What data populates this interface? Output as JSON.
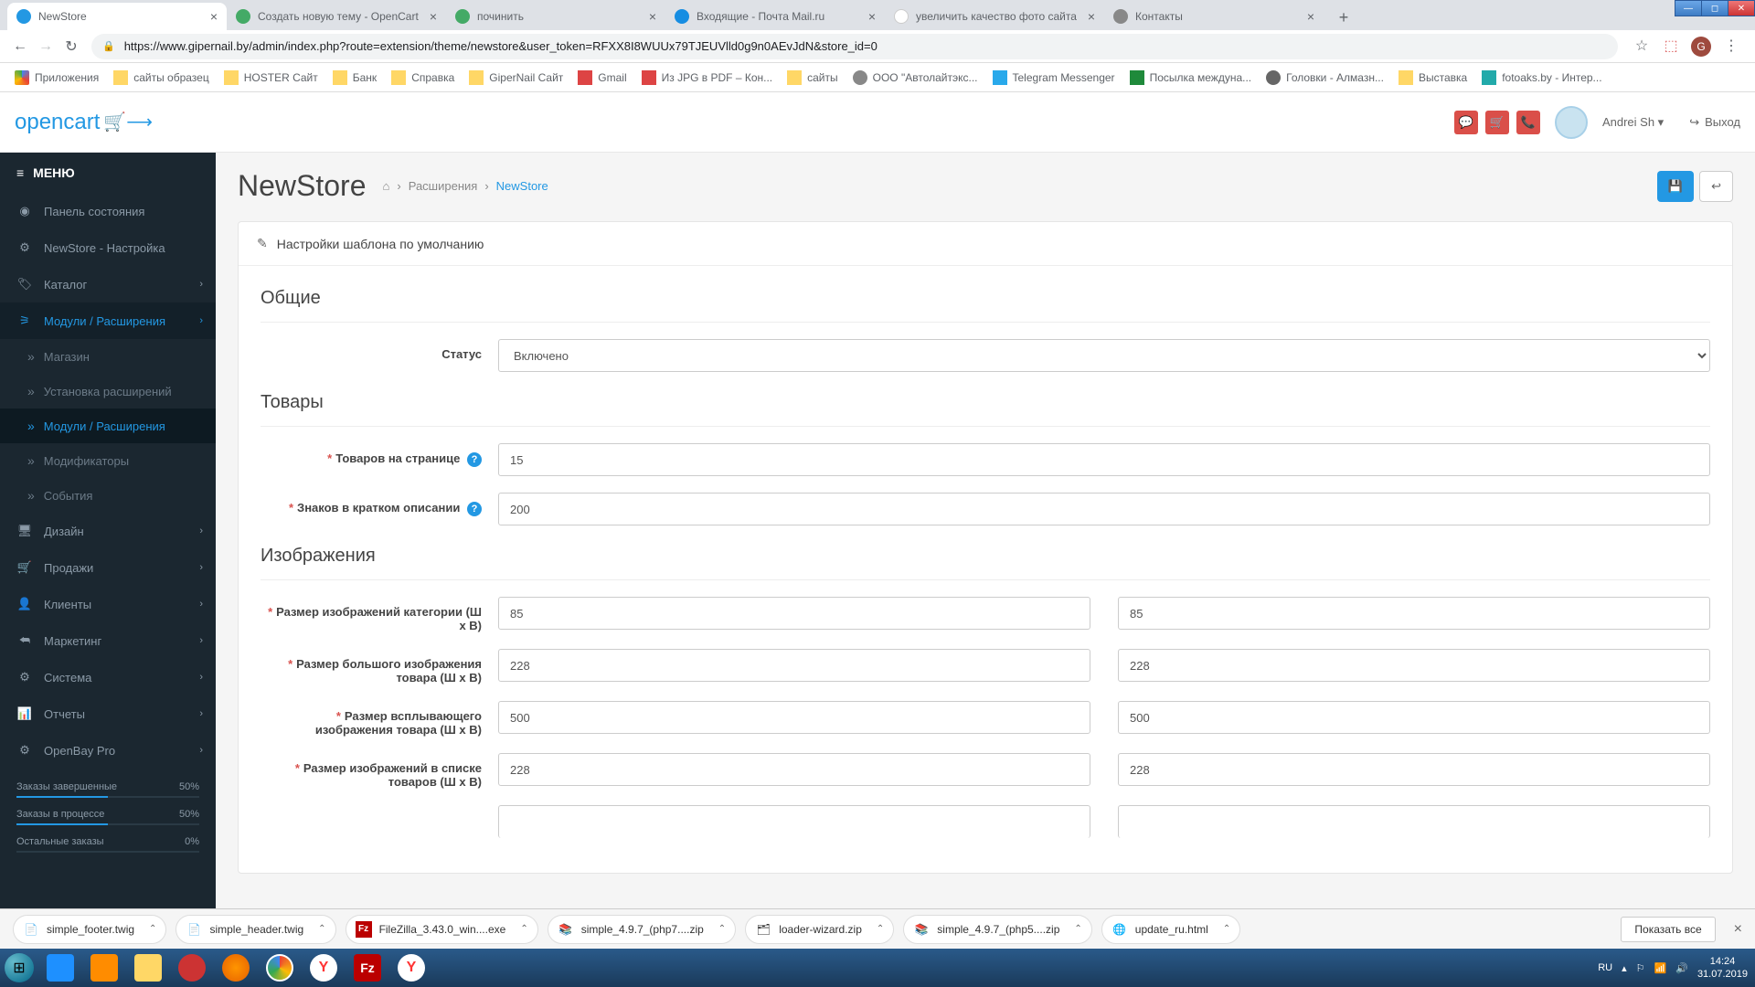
{
  "browser": {
    "tabs": [
      {
        "title": "NewStore",
        "active": true
      },
      {
        "title": "Создать новую тему - OpenCart"
      },
      {
        "title": "починить"
      },
      {
        "title": "Входящие - Почта Mail.ru"
      },
      {
        "title": "увеличить качество фото сайта"
      },
      {
        "title": "Контакты"
      }
    ],
    "url": "https://www.gipernail.by/admin/index.php?route=extension/theme/newstore&user_token=RFXX8I8WUUx79TJEUVlld0g9n0AEvJdN&store_id=0",
    "bookmarks": [
      {
        "label": "Приложения",
        "folder": false
      },
      {
        "label": "сайты образец",
        "folder": true
      },
      {
        "label": "HOSTER Сайт",
        "folder": true
      },
      {
        "label": "Банк",
        "folder": true
      },
      {
        "label": "Справка",
        "folder": true
      },
      {
        "label": "GiperNail Сайт",
        "folder": true
      },
      {
        "label": "Gmail",
        "folder": false
      },
      {
        "label": "Из JPG в PDF – Кон...",
        "folder": false
      },
      {
        "label": "сайты",
        "folder": true
      },
      {
        "label": "ООО \"Автолайтэкс...",
        "folder": false
      },
      {
        "label": "Telegram Messenger",
        "folder": false
      },
      {
        "label": "Посылка междуна...",
        "folder": false
      },
      {
        "label": "Головки - Алмазн...",
        "folder": false
      },
      {
        "label": "Выставка",
        "folder": true
      },
      {
        "label": "fotoaks.by - Интер...",
        "folder": false
      }
    ]
  },
  "header": {
    "logo": "opencart",
    "username": "Andrei Sh",
    "logout": "Выход"
  },
  "sidebar": {
    "menu_label": "МЕНЮ",
    "items": [
      {
        "label": "Панель состояния"
      },
      {
        "label": "NewStore - Настройка"
      },
      {
        "label": "Каталог",
        "expandable": true
      },
      {
        "label": "Модули / Расширения",
        "expandable": true,
        "active": true
      },
      {
        "label": "Дизайн",
        "expandable": true
      },
      {
        "label": "Продажи",
        "expandable": true
      },
      {
        "label": "Клиенты",
        "expandable": true
      },
      {
        "label": "Маркетинг",
        "expandable": true
      },
      {
        "label": "Система",
        "expandable": true
      },
      {
        "label": "Отчеты",
        "expandable": true
      },
      {
        "label": "OpenBay Pro",
        "expandable": true
      }
    ],
    "subitems": [
      {
        "label": "Магазин"
      },
      {
        "label": "Установка расширений"
      },
      {
        "label": "Модули / Расширения",
        "active": true
      },
      {
        "label": "Модификаторы"
      },
      {
        "label": "События"
      }
    ],
    "stats": [
      {
        "label": "Заказы завершенные",
        "value": "50%",
        "pct": 50
      },
      {
        "label": "Заказы в процессе",
        "value": "50%",
        "pct": 50
      },
      {
        "label": "Остальные заказы",
        "value": "0%",
        "pct": 0
      }
    ]
  },
  "page": {
    "title": "NewStore",
    "breadcrumb": [
      "Расширения",
      "NewStore"
    ],
    "panel_title": "Настройки шаблона по умолчанию",
    "sections": {
      "general": "Общие",
      "products": "Товары",
      "images": "Изображения"
    },
    "fields": {
      "status_label": "Статус",
      "status_value": "Включено",
      "products_per_page_label": "Товаров на странице",
      "products_per_page_value": "15",
      "short_desc_label": "Знаков в кратком описании",
      "short_desc_value": "200",
      "cat_img_label": "Размер изображений категории (Ш x В)",
      "cat_img_w": "85",
      "cat_img_h": "85",
      "big_img_label": "Размер большого изображения товара (Ш x В)",
      "big_img_w": "228",
      "big_img_h": "228",
      "popup_img_label": "Размер всплывающего изображения товара (Ш x В)",
      "popup_img_w": "500",
      "popup_img_h": "500",
      "list_img_label": "Размер изображений в списке товаров (Ш x В)",
      "list_img_w": "228",
      "list_img_h": "228"
    }
  },
  "downloads": {
    "items": [
      {
        "name": "simple_footer.twig",
        "icon": "file"
      },
      {
        "name": "simple_header.twig",
        "icon": "file"
      },
      {
        "name": "FileZilla_3.43.0_win....exe",
        "icon": "fz"
      },
      {
        "name": "simple_4.9.7_(php7....zip",
        "icon": "rar"
      },
      {
        "name": "loader-wizard.zip",
        "icon": "zip"
      },
      {
        "name": "simple_4.9.7_(php5....zip",
        "icon": "rar"
      },
      {
        "name": "update_ru.html",
        "icon": "html"
      }
    ],
    "show_all": "Показать все"
  },
  "tray": {
    "lang": "RU",
    "time": "14:24",
    "date": "31.07.2019"
  }
}
